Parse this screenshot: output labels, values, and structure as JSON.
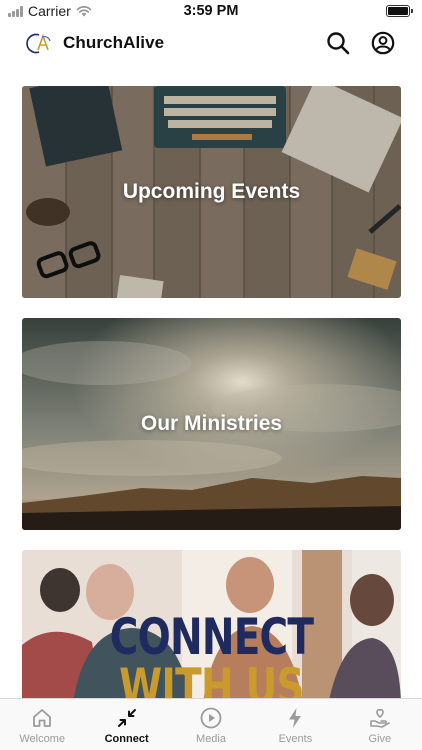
{
  "status_bar": {
    "carrier": "Carrier",
    "time": "3:59 PM"
  },
  "header": {
    "app_name": "ChurchAlive",
    "logo_icon": "churchalive-logo",
    "search_icon": "search-icon",
    "profile_icon": "profile-icon"
  },
  "cards": [
    {
      "title": "Upcoming Events"
    },
    {
      "title": "Our Ministries"
    },
    {
      "title": "CONNECT WITH US",
      "line1": "CONNECT",
      "line2": "WITH US"
    }
  ],
  "tabs": [
    {
      "label": "Welcome",
      "icon": "home-icon",
      "active": false
    },
    {
      "label": "Connect",
      "icon": "connect-arrows-icon",
      "active": true
    },
    {
      "label": "Media",
      "icon": "play-icon",
      "active": false
    },
    {
      "label": "Events",
      "icon": "lightning-icon",
      "active": false
    },
    {
      "label": "Give",
      "icon": "heart-hand-icon",
      "active": false
    }
  ],
  "colors": {
    "active_tab": "#111111",
    "inactive_tab": "#9b9b9b",
    "connect_navy": "#1f2b5e",
    "connect_gold": "#c89b2c"
  }
}
